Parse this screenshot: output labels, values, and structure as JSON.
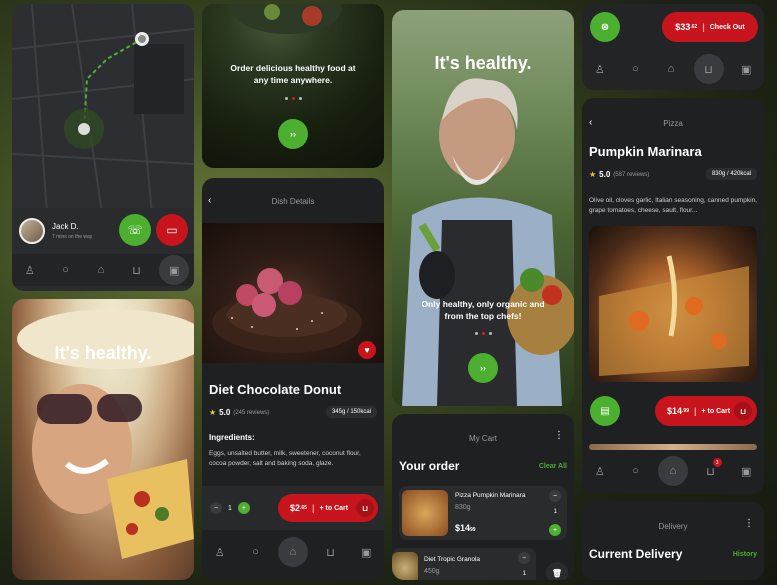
{
  "map_card": {
    "driver_name": "Jack D.",
    "driver_status": "7 mins on the way"
  },
  "onboard_food": {
    "text": "Order delicious healthy food at any time anywhere.",
    "next_label": "››"
  },
  "healthy_woman": {
    "title": "It's healthy."
  },
  "dish_details": {
    "header": "Dish Details",
    "name": "Diet Chocolate Donut",
    "rating": "5.0",
    "reviews": "(245 reviews)",
    "weight": "345g / 150kcal",
    "ingredients_label": "Ingredients:",
    "ingredients": "Eggs, unsalted butter, milk, sweetener, coconut flour, cocoa powder, salt and baking soda, glaze.",
    "quantity": "1",
    "price_main": "$2",
    "price_cents": ".65",
    "cart_label": "+ to Cart"
  },
  "healthy_farmer": {
    "title": "It's healthy.",
    "subtitle": "Only healthy, only organic and from the top chefs!",
    "next_label": "››"
  },
  "my_cart": {
    "header": "My Cart",
    "title": "Your order",
    "clear_all": "Clear All",
    "items": [
      {
        "name": "Pizza Pumpkin Marinara",
        "weight": "830g",
        "price_main": "$14",
        "price_cents": "99",
        "qty": "1"
      },
      {
        "name": "Diet Tropic Granola",
        "weight": "450g",
        "price_main": "",
        "price_cents": "",
        "qty": "1"
      }
    ]
  },
  "checkout_bar": {
    "price_main": "$33",
    "price_cents": ".62",
    "action": "Check Out"
  },
  "pizza_details": {
    "header": "Pizza",
    "name": "Pumpkin Marinara",
    "rating": "5.0",
    "reviews": "(587 reviews)",
    "weight": "830g / 420kcal",
    "description": "Olive oil, cloves garlic, Italian seasoning, canned pumpkin, grape tomatoes, cheese, sault, flour...",
    "price_main": "$14",
    "price_cents": ".99",
    "cart_label": "+ to Cart",
    "cart_badge": "3"
  },
  "delivery": {
    "header": "Delivery",
    "title": "Current Delivery",
    "history": "History"
  },
  "colors": {
    "accent_green": "#4caf2f",
    "accent_red": "#c8141c",
    "card_dark": "#1f2022"
  }
}
